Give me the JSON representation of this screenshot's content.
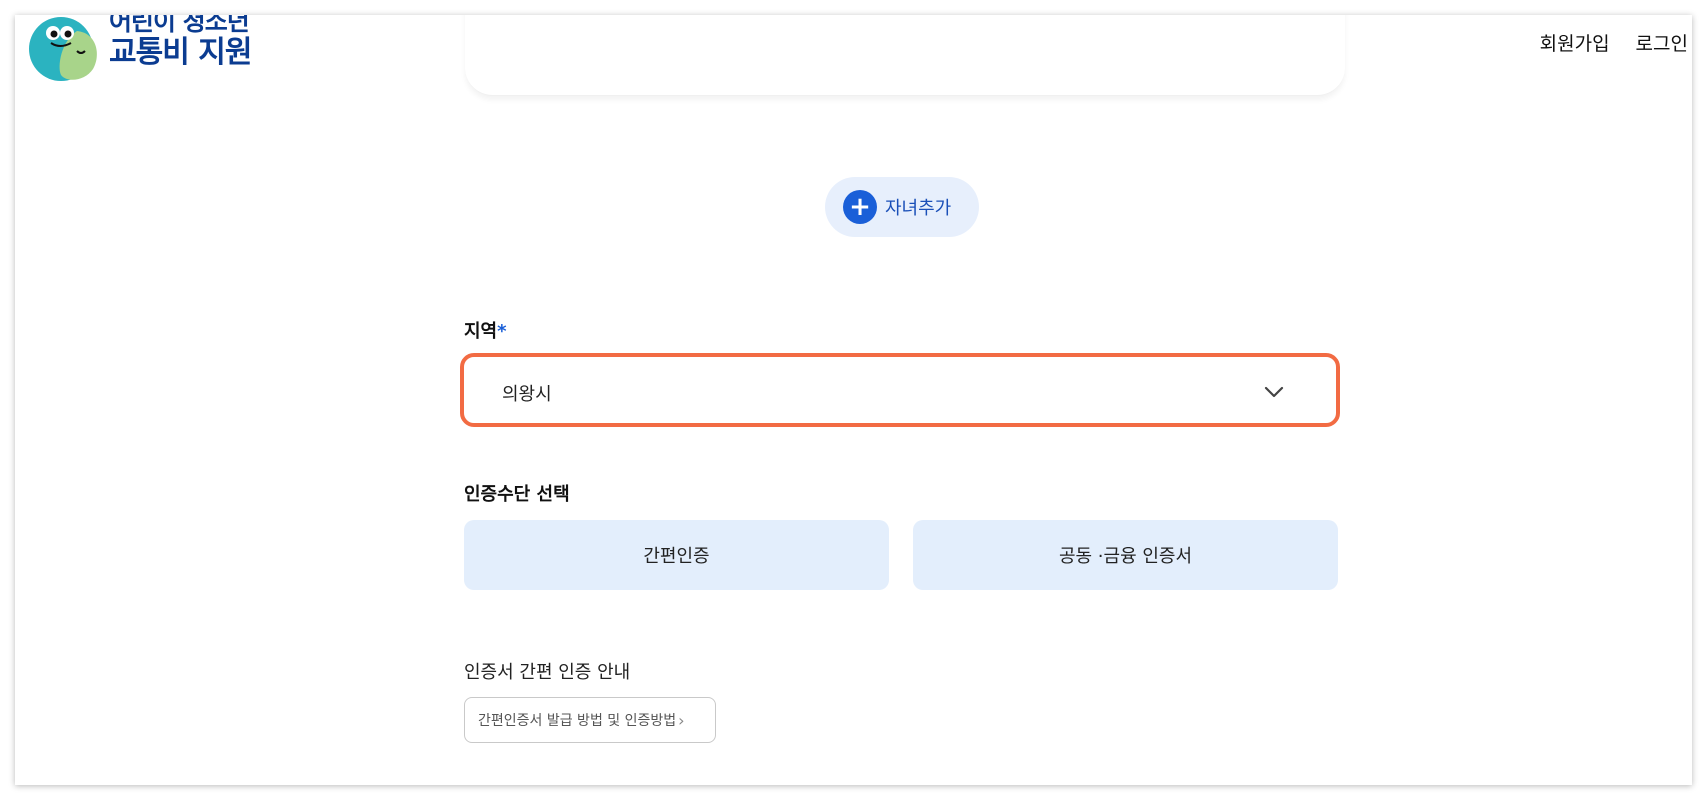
{
  "header": {
    "logo_line1": "어린이 청소년",
    "logo_line2": "교통비 지원",
    "nav_signup": "회원가입",
    "nav_login": "로그인"
  },
  "add_child": {
    "label": "자녀추가",
    "icon": "plus-icon"
  },
  "region": {
    "label": "지역",
    "required_mark": "*",
    "selected_value": "의왕시",
    "icon": "chevron-down-icon"
  },
  "auth": {
    "title": "인증수단 선택",
    "option_simple": "간편인증",
    "option_certificate": "공동 ·금융 인증서"
  },
  "guide": {
    "title": "인증서 간편 인증 안내",
    "link_label": "간편인증서 발급 방법 및 인증방법",
    "link_icon": "chevron-right-icon"
  },
  "colors": {
    "brand_blue": "#0b3c91",
    "accent_blue": "#1a5fd8",
    "highlight_orange": "#f26b43",
    "button_bg": "#e3eefc"
  }
}
